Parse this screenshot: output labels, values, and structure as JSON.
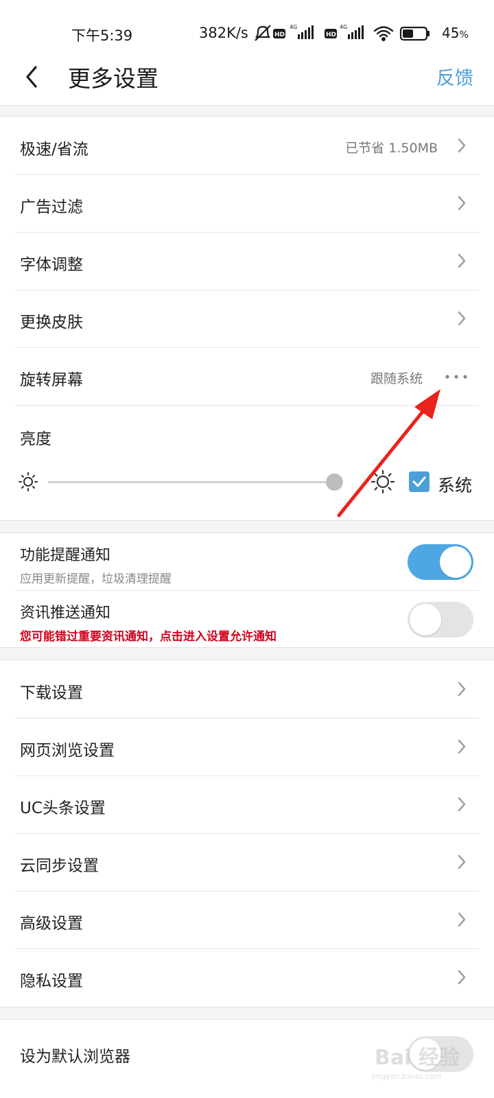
{
  "status_bar": {
    "time": "下午5:39",
    "net_speed": "382K/s",
    "battery_percent": "45",
    "battery_unit": "%",
    "network_badge": "4G",
    "hd_badge": "HD",
    "icons": [
      "mute-icon",
      "signal-icon",
      "wifi-icon",
      "battery-icon"
    ]
  },
  "header": {
    "title": "更多设置",
    "feedback_label": "反馈"
  },
  "group1": [
    {
      "label": "极速/省流",
      "value": "已节省 1.50MB"
    },
    {
      "label": "广告过滤",
      "value": ""
    },
    {
      "label": "字体调整",
      "value": ""
    },
    {
      "label": "更换皮肤",
      "value": ""
    }
  ],
  "rotate": {
    "label": "旋转屏幕",
    "value": "跟随系统"
  },
  "brightness": {
    "label": "亮度",
    "level": 0.97,
    "system_label": "系统",
    "system_checked": true
  },
  "notifications": [
    {
      "title": "功能提醒通知",
      "subtitle": "应用更新提醒，垃圾清理提醒",
      "enabled": true
    },
    {
      "title": "资讯推送通知",
      "warning": "您可能错过重要资讯通知，点击进入设置允许通知",
      "enabled": false
    }
  ],
  "group3": [
    {
      "label": "下载设置"
    },
    {
      "label": "网页浏览设置"
    },
    {
      "label": "UC头条设置"
    },
    {
      "label": "云同步设置"
    },
    {
      "label": "高级设置"
    },
    {
      "label": "隐私设置"
    }
  ],
  "default_browser": {
    "label": "设为默认浏览器"
  },
  "watermark": {
    "text": "Bai 经验",
    "url": "jingyan.baidu.com"
  },
  "colors": {
    "accent": "#4b9fd8",
    "toggle_on": "#4ea7e3",
    "warning": "#d0021b",
    "annotation_arrow": "#e8231b"
  }
}
